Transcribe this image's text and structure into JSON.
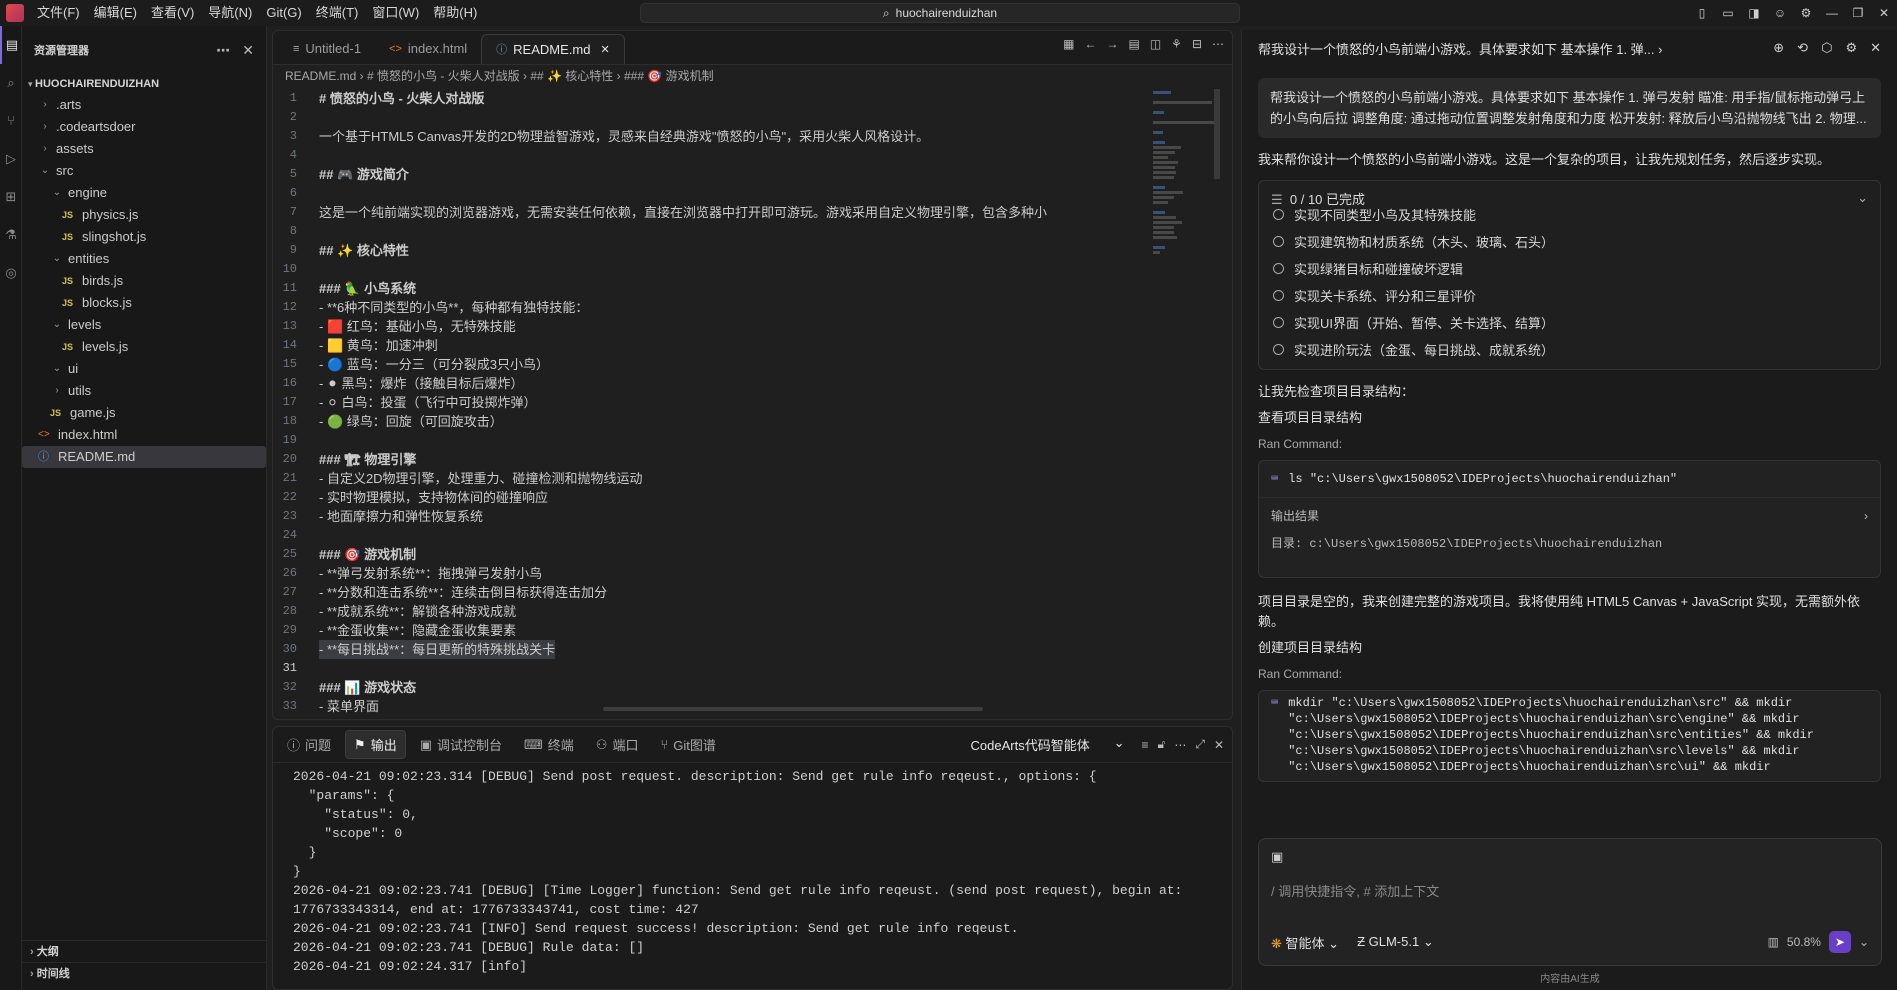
{
  "menu": [
    "文件(F)",
    "编辑(E)",
    "查看(V)",
    "导航(N)",
    "Git(G)",
    "终端(T)",
    "窗口(W)",
    "帮助(H)"
  ],
  "search_title": "huochairenduizhan",
  "explorer": {
    "title": "资源管理器",
    "root": "HUOCHAIRENDUIZHAN",
    "items": [
      {
        "label": ".arts",
        "type": "folder",
        "depth": 1,
        "expanded": false
      },
      {
        "label": ".codeartsdoer",
        "type": "folder",
        "depth": 1,
        "expanded": false
      },
      {
        "label": "assets",
        "type": "folder",
        "depth": 1,
        "expanded": false
      },
      {
        "label": "src",
        "type": "folder",
        "depth": 1,
        "expanded": true
      },
      {
        "label": "engine",
        "type": "folder",
        "depth": 2,
        "expanded": true
      },
      {
        "label": "physics.js",
        "type": "js",
        "depth": 3
      },
      {
        "label": "slingshot.js",
        "type": "js",
        "depth": 3
      },
      {
        "label": "entities",
        "type": "folder",
        "depth": 2,
        "expanded": true
      },
      {
        "label": "birds.js",
        "type": "js",
        "depth": 3
      },
      {
        "label": "blocks.js",
        "type": "js",
        "depth": 3
      },
      {
        "label": "levels",
        "type": "folder",
        "depth": 2,
        "expanded": true
      },
      {
        "label": "levels.js",
        "type": "js",
        "depth": 3
      },
      {
        "label": "ui",
        "type": "folder",
        "depth": 2,
        "expanded": true
      },
      {
        "label": "utils",
        "type": "folder",
        "depth": 2,
        "expanded": false
      },
      {
        "label": "game.js",
        "type": "js",
        "depth": 2
      },
      {
        "label": "index.html",
        "type": "html",
        "depth": 1
      },
      {
        "label": "README.md",
        "type": "info",
        "depth": 1,
        "selected": true
      }
    ],
    "outline": "大纲",
    "timeline": "时间线"
  },
  "tabs": [
    {
      "label": "Untitled-1",
      "icon": "≡",
      "active": false
    },
    {
      "label": "index.html",
      "icon": "<>",
      "active": false
    },
    {
      "label": "README.md",
      "icon": "ⓘ",
      "active": true
    }
  ],
  "breadcrumb": "README.md  ›  # 愤怒的小鸟 - 火柴人对战版  ›  ## ✨ 核心特性  ›  ### 🎯 游戏机制",
  "code_lines": [
    {
      "n": "1",
      "t": "# 愤怒的小鸟 - 火柴人对战版",
      "c": "h1"
    },
    {
      "n": "2",
      "t": "",
      "c": ""
    },
    {
      "n": "3",
      "t": "一个基于HTML5 Canvas开发的2D物理益智游戏，灵感来自经典游戏\"愤怒的小鸟\"，采用火柴人风格设计。",
      "c": ""
    },
    {
      "n": "4",
      "t": "",
      "c": ""
    },
    {
      "n": "5",
      "t": "## 🎮 游戏简介",
      "c": "h2"
    },
    {
      "n": "6",
      "t": "",
      "c": ""
    },
    {
      "n": "7",
      "t": "这是一个纯前端实现的浏览器游戏，无需安装任何依赖，直接在浏览器中打开即可游玩。游戏采用自定义物理引擎，包含多种小",
      "c": ""
    },
    {
      "n": "8",
      "t": "",
      "c": ""
    },
    {
      "n": "9",
      "t": "## ✨ 核心特性",
      "c": "h2"
    },
    {
      "n": "10",
      "t": "",
      "c": ""
    },
    {
      "n": "11",
      "t": "### 🦜 小鸟系统",
      "c": "h2"
    },
    {
      "n": "12",
      "t": "- **6种不同类型的小鸟**，每种都有独特技能：",
      "c": "list"
    },
    {
      "n": "13",
      "t": "  - 🟥 红鸟：基础小鸟，无特殊技能",
      "c": ""
    },
    {
      "n": "14",
      "t": "  - 🟨 黄鸟：加速冲刺",
      "c": ""
    },
    {
      "n": "15",
      "t": "  - 🔵 蓝鸟：一分三（可分裂成3只小鸟）",
      "c": ""
    },
    {
      "n": "16",
      "t": "  - ⚫ 黑鸟：爆炸（接触目标后爆炸）",
      "c": ""
    },
    {
      "n": "17",
      "t": "  - ⚪ 白鸟：投蛋（飞行中可投掷炸弹）",
      "c": ""
    },
    {
      "n": "18",
      "t": "  - 🟢 绿鸟：回旋（可回旋攻击）",
      "c": ""
    },
    {
      "n": "19",
      "t": "",
      "c": ""
    },
    {
      "n": "20",
      "t": "### 🏗 物理引擎",
      "c": "h2"
    },
    {
      "n": "21",
      "t": "- 自定义2D物理引擎，处理重力、碰撞检测和抛物线运动",
      "c": "list"
    },
    {
      "n": "22",
      "t": "- 实时物理模拟，支持物体间的碰撞响应",
      "c": "list"
    },
    {
      "n": "23",
      "t": "- 地面摩擦力和弹性恢复系统",
      "c": "list"
    },
    {
      "n": "24",
      "t": "",
      "c": ""
    },
    {
      "n": "25",
      "t": "### 🎯 游戏机制",
      "c": "h2"
    },
    {
      "n": "26",
      "t": "- **弹弓发射系统**：拖拽弹弓发射小鸟",
      "c": "list"
    },
    {
      "n": "27",
      "t": "- **分数和连击系统**：连续击倒目标获得连击加分",
      "c": "list"
    },
    {
      "n": "28",
      "t": "- **成就系统**：解锁各种游戏成就",
      "c": "list"
    },
    {
      "n": "29",
      "t": "- **金蛋收集**：隐藏金蛋收集要素",
      "c": "list"
    },
    {
      "n": "30",
      "t": "- **每日挑战**：每日更新的特殊挑战关卡",
      "c": "list"
    },
    {
      "n": "31",
      "t": "",
      "c": "current"
    },
    {
      "n": "32",
      "t": "### 📊 游戏状态",
      "c": "h2"
    },
    {
      "n": "33",
      "t": "- 菜单界面",
      "c": "list"
    }
  ],
  "panel": {
    "tabs": [
      {
        "label": "问题",
        "icon": "ⓘ",
        "active": false
      },
      {
        "label": "输出",
        "icon": "⚑",
        "active": true
      },
      {
        "label": "调试控制台",
        "icon": "▣",
        "active": false
      },
      {
        "label": "终端",
        "icon": "⌨",
        "active": false
      },
      {
        "label": "端口",
        "icon": "⚇",
        "active": false
      },
      {
        "label": "Git图谱",
        "icon": "⑂",
        "active": false
      }
    ],
    "output_source": "CodeArts代码智能体",
    "log": [
      "2026-04-21 09:02:23.314 [DEBUG] Send post request. description: Send get rule info reqeust., options: {",
      "  \"params\": {",
      "    \"status\": 0,",
      "    \"scope\": 0",
      "  }",
      "}",
      "2026-04-21 09:02:23.741 [DEBUG] [Time Logger] function: Send get rule info reqeust. (send post request), begin at:",
      "1776733343314, end at: 1776733343741, cost time: 427",
      "2026-04-21 09:02:23.741 [INFO] Send request success! description: Send get rule info reqeust.",
      "2026-04-21 09:02:23.741 [DEBUG] Rule data: []",
      "2026-04-21 09:02:24.317 [info]"
    ]
  },
  "chat": {
    "title": "帮我设计一个愤怒的小鸟前端小游戏。具体要求如下 基本操作 1. 弹...",
    "user_message": "帮我设计一个愤怒的小鸟前端小游戏。具体要求如下 基本操作 1. 弹弓发射 瞄准: 用手指/鼠标拖动弹弓上的小鸟向后拉 调整角度: 通过拖动位置调整发射角度和力度 松开发射: 释放后小鸟沿抛物线飞出 2. 物理...",
    "intro": "我来帮你设计一个愤怒的小鸟前端小游戏。这是一个复杂的项目，让我先规划任务，然后逐步实现。",
    "todo_title": "0 / 10 已完成",
    "todos": [
      "实现不同类型小鸟及其特殊技能",
      "实现建筑物和材质系统（木头、玻璃、石头）",
      "实现绿猪目标和碰撞破坏逻辑",
      "实现关卡系统、评分和三星评价",
      "实现UI界面（开始、暂停、关卡选择、结算）",
      "实现进阶玩法（金蛋、每日挑战、成就系统）"
    ],
    "check_dir": "让我先检查项目目录结构：",
    "step1_title": "查看项目目录结构",
    "ran_label": "Ran Command:",
    "cmd1": "ls \"c:\\Users\\gwx1508052\\IDEProjects\\huochairenduizhan\"",
    "output_label": "输出结果",
    "output_text": "目录: c:\\Users\\gwx1508052\\IDEProjects\\huochairenduizhan",
    "empty_note": "项目目录是空的，我来创建完整的游戏项目。我将使用纯 HTML5 Canvas + JavaScript 实现，无需额外依赖。",
    "step2_title": "创建项目目录结构",
    "ran_label2": "Ran Command:",
    "cmd2": [
      "mkdir \"c:\\Users\\gwx1508052\\IDEProjects\\huochairenduizhan\\src\" && mkdir",
      "\"c:\\Users\\gwx1508052\\IDEProjects\\huochairenduizhan\\src\\engine\" && mkdir",
      "\"c:\\Users\\gwx1508052\\IDEProjects\\huochairenduizhan\\src\\entities\" && mkdir",
      "\"c:\\Users\\gwx1508052\\IDEProjects\\huochairenduizhan\\src\\levels\" && mkdir",
      "\"c:\\Users\\gwx1508052\\IDEProjects\\huochairenduizhan\\src\\ui\" && mkdir"
    ],
    "input_placeholder": "/ 调用快捷指令, # 添加上下文",
    "agent_mode": "智能体",
    "model": "GLM-5.1",
    "context_usage": "50.8%",
    "footer": "内容由AI生成"
  },
  "colors": {
    "accent": "#7b68ee",
    "send": "#6a3fc7",
    "heading": "#569cd6"
  }
}
